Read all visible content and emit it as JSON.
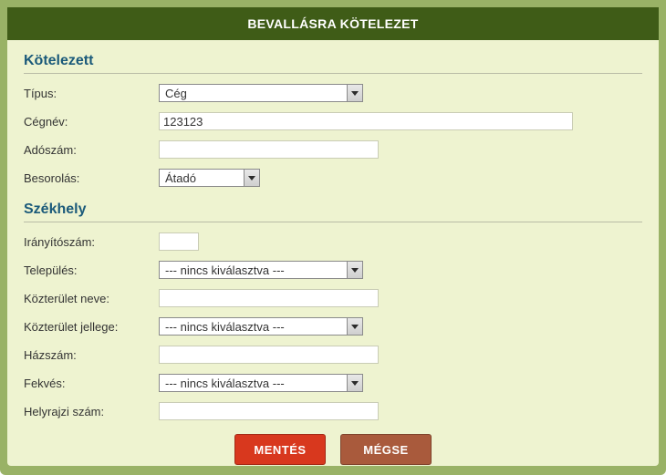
{
  "header": {
    "title": "BEVALLÁSRA KÖTELEZET"
  },
  "sections": {
    "kotelezett": {
      "title": "Kötelezett",
      "fields": {
        "tipus": {
          "label": "Típus:",
          "value": "Cég"
        },
        "cegnev": {
          "label": "Cégnév:",
          "value": "123123"
        },
        "adoszam": {
          "label": "Adószám:",
          "value": ""
        },
        "besorolas": {
          "label": "Besorolás:",
          "value": "Átadó"
        }
      }
    },
    "szekhely": {
      "title": "Székhely",
      "fields": {
        "iranyitoszam": {
          "label": "Irányítószám:",
          "value": ""
        },
        "telepules": {
          "label": "Település:",
          "value": "--- nincs kiválasztva ---"
        },
        "kozterulet_neve": {
          "label": "Közterület neve:",
          "value": ""
        },
        "kozterulet_jellege": {
          "label": "Közterület jellege:",
          "value": "--- nincs kiválasztva ---"
        },
        "hazszam": {
          "label": "Házszám:",
          "value": ""
        },
        "fekves": {
          "label": "Fekvés:",
          "value": "--- nincs kiválasztva ---"
        },
        "helyrajzi_szam": {
          "label": "Helyrajzi szám:",
          "value": ""
        }
      }
    }
  },
  "buttons": {
    "save": "MENTÉS",
    "cancel": "MÉGSE"
  }
}
